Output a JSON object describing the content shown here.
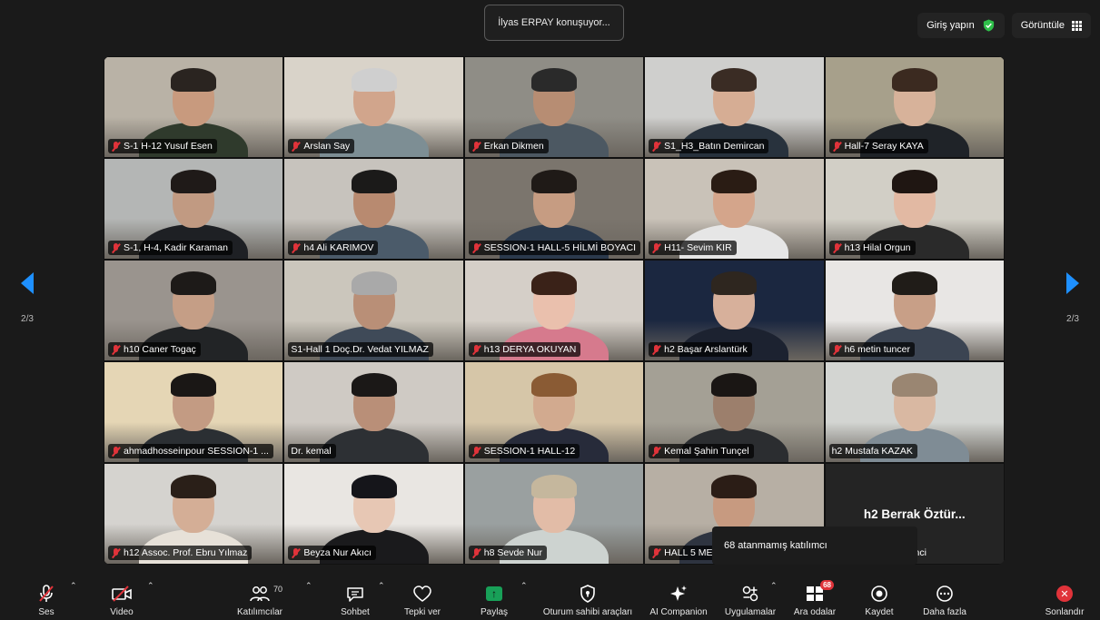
{
  "speaker_banner": "İlyas ERPAY konuşuyor...",
  "top_right": {
    "sign_in": "Giriş yapın",
    "view": "Görüntüle"
  },
  "pagination": {
    "left": "2/3",
    "right": "2/3"
  },
  "participants": [
    {
      "name": "S-1 H-12 Yusuf Esen",
      "muted": true
    },
    {
      "name": "Arslan Say",
      "muted": true
    },
    {
      "name": "Erkan Dikmen",
      "muted": true
    },
    {
      "name": "S1_H3_Batın Demircan",
      "muted": true
    },
    {
      "name": "Hall-7 Seray KAYA",
      "muted": true
    },
    {
      "name": "S-1, H-4, Kadir Karaman",
      "muted": true
    },
    {
      "name": "h4 Ali KARIMOV",
      "muted": true
    },
    {
      "name": "SESSION-1 HALL-5 HİLMİ BOYACI",
      "muted": true
    },
    {
      "name": "H11- Sevim KIR",
      "muted": true
    },
    {
      "name": "h13 Hilal Orgun",
      "muted": true
    },
    {
      "name": "h10 Caner Togaç",
      "muted": true
    },
    {
      "name": "S1-Hall 1 Doç.Dr. Vedat YILMAZ",
      "muted": false
    },
    {
      "name": "h13 DERYA OKUYAN",
      "muted": true
    },
    {
      "name": "h2 Başar Arslantürk",
      "muted": true
    },
    {
      "name": "h6 metin tuncer",
      "muted": true
    },
    {
      "name": "ahmadhosseinpour SESSION-1 ...",
      "muted": true
    },
    {
      "name": "Dr. kemal",
      "muted": false
    },
    {
      "name": "SESSION-1 HALL-12",
      "muted": true
    },
    {
      "name": "Kemal Şahin Tunçel",
      "muted": true
    },
    {
      "name": "h2 Mustafa KAZAK",
      "muted": false
    },
    {
      "name": "h12 Assoc. Prof. Ebru Yılmaz",
      "muted": true
    },
    {
      "name": "Beyza Nur Akıcı",
      "muted": true
    },
    {
      "name": "h8 Sevde Nur",
      "muted": true
    },
    {
      "name": "HALL 5 ME",
      "muted": true
    },
    {
      "name": "h2 Berrak Öztür...",
      "muted": true,
      "trailing": "kinci"
    }
  ],
  "tooltip": "68 atanmamış katılımcı",
  "toolbar": {
    "audio": "Ses",
    "video": "Video",
    "participants": "Katılımcılar",
    "participants_count": "70",
    "chat": "Sohbet",
    "react": "Tepki ver",
    "share": "Paylaş",
    "host_tools": "Oturum sahibi araçları",
    "companion": "AI Companion",
    "apps": "Uygulamalar",
    "breakout": "Ara odalar",
    "breakout_badge": "68",
    "record": "Kaydet",
    "more": "Daha fazla",
    "end": "Sonlandır"
  },
  "colors": {
    "accent_blue": "#1e90ff",
    "danger_red": "#e0333a",
    "share_green": "#18a058",
    "shield_green": "#2fbf4a"
  }
}
